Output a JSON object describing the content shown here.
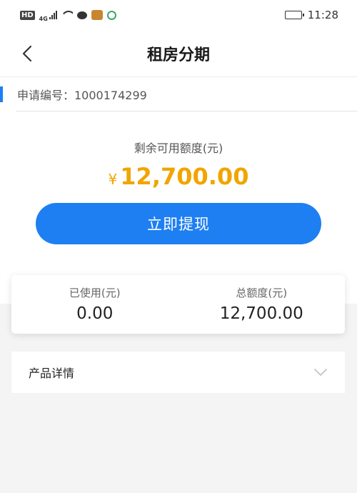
{
  "status_bar": {
    "hd": "HD",
    "network": "4G",
    "time": "11:28",
    "battery_level": 0.85
  },
  "header": {
    "title": "租房分期",
    "back_icon": "chevron-left-icon"
  },
  "application": {
    "label": "申请编号：1000174299"
  },
  "quota": {
    "label": "剩余可用额度(元)",
    "currency": "¥",
    "amount": "12,700.00",
    "amount_color": "#f0a500"
  },
  "withdraw_button": {
    "label": "立即提现",
    "color": "#1e7ff3"
  },
  "stats": {
    "used_label": "已使用(元)",
    "used_value": "0.00",
    "total_label": "总额度(元)",
    "total_value": "12,700.00"
  },
  "product_details": {
    "label": "产品详情",
    "expand_icon": "chevron-down-icon"
  }
}
